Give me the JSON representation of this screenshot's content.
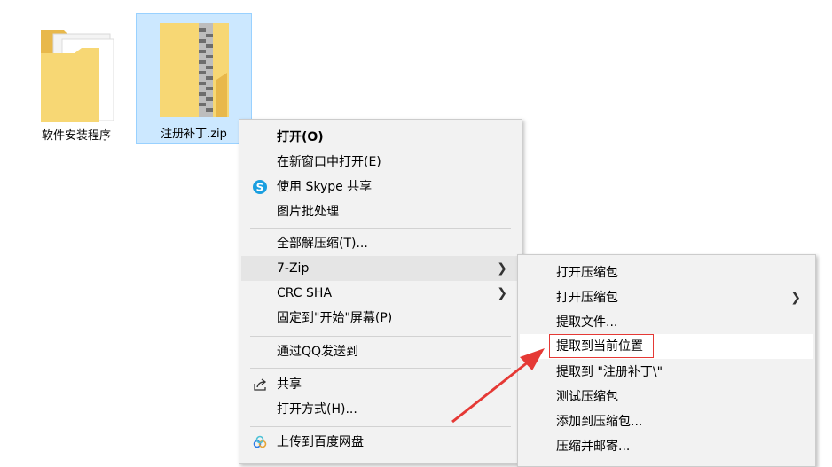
{
  "desktop": {
    "items": [
      {
        "label": "软件安装程序",
        "icon": "folder-icon"
      },
      {
        "label": "注册补丁.zip",
        "icon": "zip-folder-icon"
      }
    ]
  },
  "context_menu": {
    "items": [
      {
        "label": "打开(O)"
      },
      {
        "label": "在新窗口中打开(E)"
      },
      {
        "label": "使用 Skype 共享",
        "icon": "skype-icon"
      },
      {
        "label": "图片批处理"
      },
      {
        "label": "全部解压缩(T)..."
      },
      {
        "label": "7-Zip"
      },
      {
        "label": "CRC SHA"
      },
      {
        "label": "固定到\"开始\"屏幕(P)"
      },
      {
        "label": "通过QQ发送到"
      },
      {
        "label": "共享",
        "icon": "share-icon"
      },
      {
        "label": "打开方式(H)..."
      },
      {
        "label": "上传到百度网盘",
        "icon": "baidu-netdisk-icon"
      }
    ]
  },
  "submenu_7zip": {
    "items": [
      {
        "label": "打开压缩包"
      },
      {
        "label": "打开压缩包"
      },
      {
        "label": "提取文件..."
      },
      {
        "label": "提取到当前位置"
      },
      {
        "label": "提取到 \"注册补丁\\\""
      },
      {
        "label": "测试压缩包"
      },
      {
        "label": "添加到压缩包..."
      },
      {
        "label": "压缩并邮寄..."
      }
    ]
  },
  "colors": {
    "selection_bg": "#cce8ff",
    "menu_bg": "#f2f2f2",
    "annotation_red": "#e53935"
  }
}
